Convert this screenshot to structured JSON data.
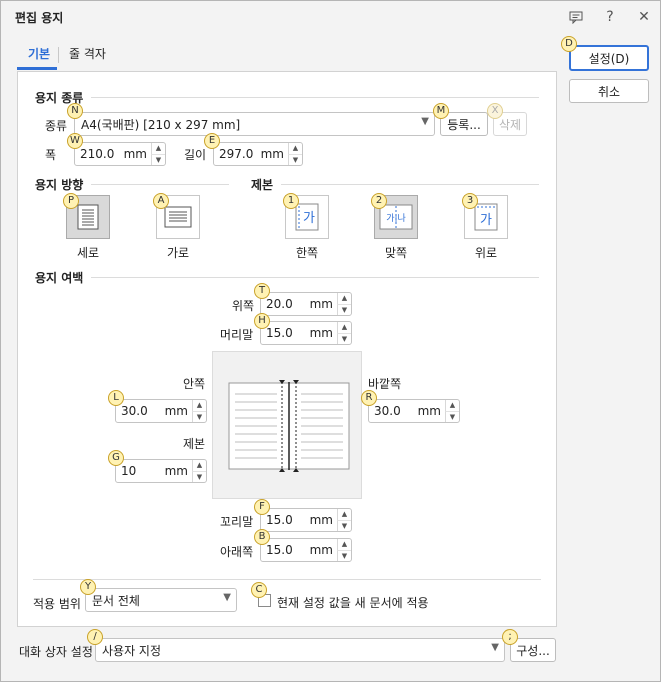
{
  "window": {
    "title": "편집 용지"
  },
  "tabs": [
    {
      "label": "기본"
    },
    {
      "label": "줄 격자"
    }
  ],
  "actions": {
    "ok_label": "설정(D)",
    "cancel_label": "취소"
  },
  "paper_type": {
    "section": "용지 종류",
    "kind_label": "종류",
    "kind_value": "A4(국배판) [210 x 297 mm]",
    "register_label": "등록...",
    "delete_label": "삭제",
    "width_label": "폭",
    "width_value": "210.0",
    "length_label": "길이",
    "length_value": "297.0",
    "unit": "mm"
  },
  "orientation": {
    "section": "용지 방향",
    "portrait": "세로",
    "landscape": "가로"
  },
  "binding": {
    "section": "제본",
    "single": "한쪽",
    "facing": "맞쪽",
    "top": "위로"
  },
  "margins": {
    "section": "용지 여백",
    "top_label": "위쪽",
    "top_value": "20.0",
    "header_label": "머리말",
    "header_value": "15.0",
    "inner_label": "안쪽",
    "inner_value": "30.0",
    "gutter_label": "제본",
    "gutter_value": "10",
    "outer_label": "바깥쪽",
    "outer_value": "30.0",
    "footer_label": "꼬리말",
    "footer_value": "15.0",
    "bottom_label": "아래쪽",
    "bottom_value": "15.0",
    "unit": "mm"
  },
  "apply": {
    "scope_label": "적용 범위",
    "scope_value": "문서 전체",
    "new_doc_label": "현재 설정 값을 새 문서에 적용"
  },
  "dialog_settings": {
    "label": "대화 상자 설정",
    "value": "사용자 지정",
    "configure_label": "구성..."
  },
  "hotkeys": {
    "ok": "D",
    "kind": "N",
    "register": "M",
    "delete": "X",
    "width": "W",
    "length": "E",
    "portrait": "P",
    "landscape": "A",
    "single": "1",
    "facing": "2",
    "top": "3",
    "margin_top": "T",
    "header": "H",
    "inner": "L",
    "gutter": "G",
    "outer": "R",
    "footer": "F",
    "bottom": "B",
    "scope": "Y",
    "new_doc": "C",
    "dialog": "/",
    "configure": ";"
  },
  "tile_glyph": {
    "single": "가",
    "facing": "가|나",
    "top": "가"
  },
  "colors": {
    "accent": "#2f6fd6",
    "badge": "#fff2b3",
    "badge_border": "#c9a22a",
    "selected_tile": "#d9d9d9"
  }
}
